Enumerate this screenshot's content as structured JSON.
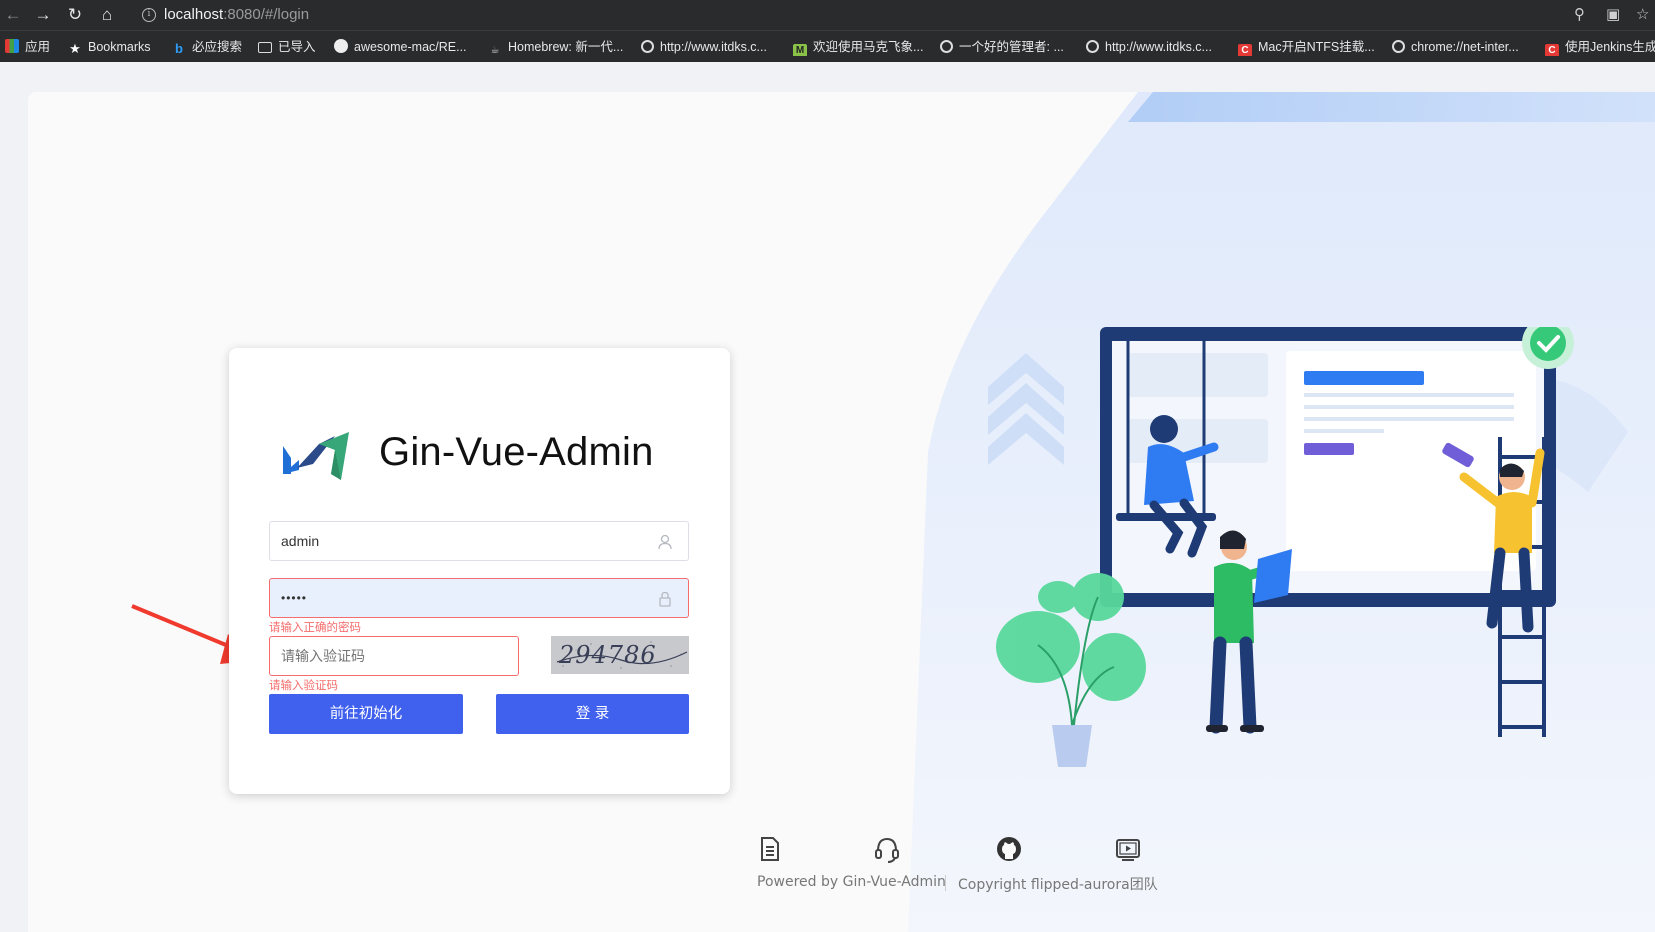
{
  "browser": {
    "url_host": "localhost",
    "url_path": ":8080/#/login",
    "bookmarks": [
      {
        "label": "应用",
        "icon": "apps-grid-icon"
      },
      {
        "label": "Bookmarks",
        "icon": "star-icon"
      },
      {
        "label": "必应搜索",
        "icon": "bing-icon"
      },
      {
        "label": "已导入",
        "icon": "folder-icon"
      },
      {
        "label": "awesome-mac/RE...",
        "icon": "github-icon"
      },
      {
        "label": "Homebrew: 新一代...",
        "icon": "homebrew-icon"
      },
      {
        "label": "http://www.itdks.c...",
        "icon": "globe-icon"
      },
      {
        "label": "欢迎使用马克飞象...",
        "icon": "maxiang-icon"
      },
      {
        "label": "一个好的管理者: ...",
        "icon": "globe-icon"
      },
      {
        "label": "http://www.itdks.c...",
        "icon": "globe-icon"
      },
      {
        "label": "Mac开启NTFS挂载...",
        "icon": "csdn-icon"
      },
      {
        "label": "chrome://net-inter...",
        "icon": "globe-icon"
      },
      {
        "label": "使用Jenkins生成",
        "icon": "csdn-icon"
      }
    ]
  },
  "login": {
    "app_title": "Gin-Vue-Admin",
    "username_value": "admin",
    "password_value": "•••••",
    "password_error": "请输入正确的密码",
    "captcha_placeholder": "请输入验证码",
    "captcha_error": "请输入验证码",
    "captcha_text": "294786",
    "init_button": "前往初始化",
    "login_button": "登 录"
  },
  "footer": {
    "powered_by_label": "Powered by",
    "powered_by_name": "Gin-Vue-Admin",
    "copyright_label": "Copyright",
    "copyright_name": "flipped-aurora团队"
  },
  "colors": {
    "primary": "#4060ee",
    "error": "#f56c6c",
    "annotation_arrow": "#f03a2e"
  }
}
